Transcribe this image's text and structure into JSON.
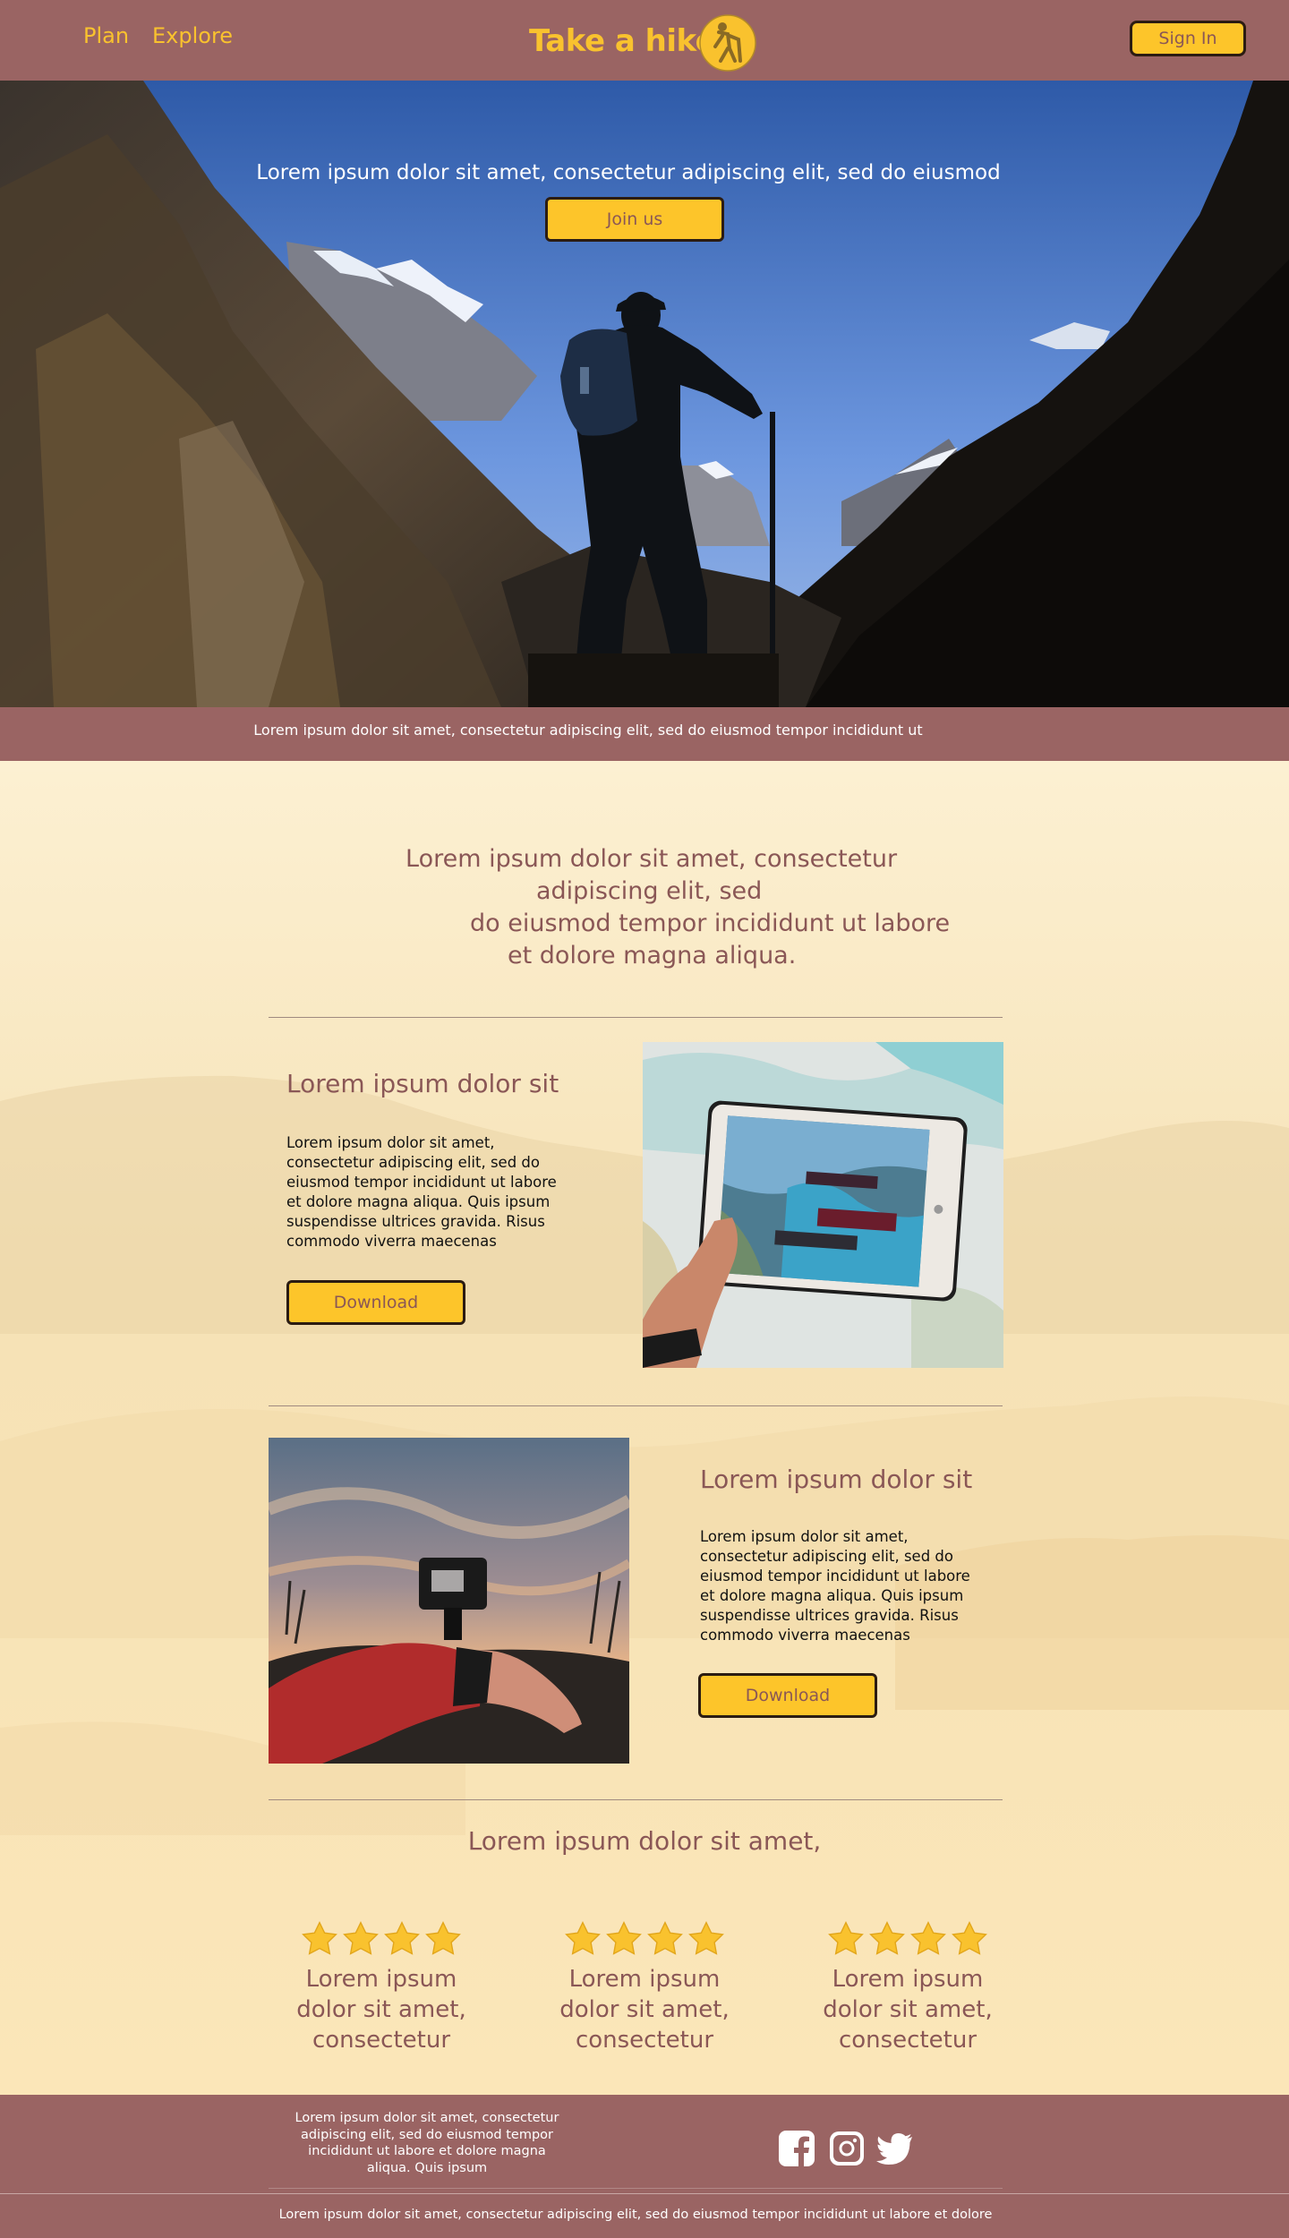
{
  "nav": {
    "links": [
      "Plan",
      "Explore"
    ],
    "logo_text": "Take a hike",
    "signin_label": "Sign In"
  },
  "hero": {
    "tagline": "Lorem ipsum dolor sit amet, consectetur adipiscing elit, sed do eiusmod",
    "cta_label": "Join us"
  },
  "strip_text": "Lorem ipsum dolor sit amet, consectetur adipiscing elit, sed do eiusmod tempor incididunt ut",
  "intro": {
    "lines": [
      "Lorem ipsum dolor sit amet, consectetur",
      "adipiscing elit, sed",
      "do eiusmod tempor incididunt ut labore",
      "et dolore magna aliqua."
    ]
  },
  "features": [
    {
      "title": "Lorem ipsum dolor sit",
      "body": "Lorem ipsum dolor sit amet, consectetur adipiscing elit, sed do eiusmod tempor incididunt ut labore et dolore magna aliqua. Quis ipsum suspendisse ultrices gravida. Risus commodo viverra maecenas",
      "button_label": "Download"
    },
    {
      "title": "Lorem ipsum dolor sit",
      "body": "Lorem ipsum dolor sit amet, consectetur adipiscing elit, sed do eiusmod tempor incididunt ut labore et dolore magna aliqua. Quis ipsum suspendisse ultrices gravida. Risus commodo viverra maecenas",
      "button_label": "Download"
    }
  ],
  "reviews": {
    "title": "Lorem ipsum dolor sit amet,",
    "items": [
      {
        "stars": 4,
        "text": "Lorem ipsum dolor sit amet, consectetur"
      },
      {
        "stars": 4,
        "text": "Lorem ipsum dolor sit amet, consectetur"
      },
      {
        "stars": 4,
        "text": "Lorem ipsum dolor sit amet, consectetur"
      }
    ]
  },
  "footer": {
    "text": "Lorem ipsum dolor sit amet, consectetur adipiscing elit, sed do eiusmod tempor incididunt ut labore et dolore magna aliqua. Quis ipsum",
    "social_icons": [
      "facebook-icon",
      "instagram-icon",
      "twitter-icon"
    ],
    "copyright": "Lorem ipsum dolor sit amet, consectetur adipiscing elit, sed do eiusmod tempor incididunt ut labore et dolore"
  },
  "colors": {
    "brand": "#9a6463",
    "accent": "#fdc52a",
    "heading": "#8a5756",
    "background": "#fbefd0"
  }
}
